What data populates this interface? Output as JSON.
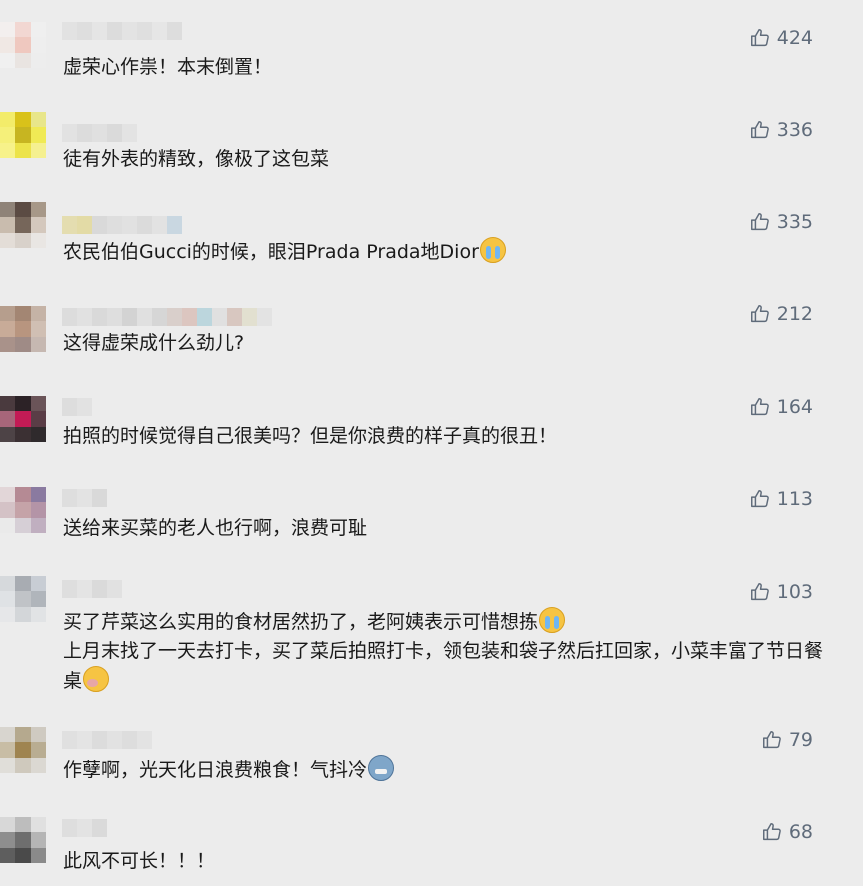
{
  "comments": [
    {
      "text": "虚荣心作祟！本末倒置！",
      "likes": "424"
    },
    {
      "text": "徒有外表的精致，像极了这包菜",
      "likes": "336"
    },
    {
      "text": "农民伯伯Gucci的时候，眼泪Prada Prada地Dior",
      "likes": "335"
    },
    {
      "text": "这得虚荣成什么劲儿?",
      "likes": "212"
    },
    {
      "text": "拍照的时候觉得自己很美吗？但是你浪费的样子真的很丑！",
      "likes": "164"
    },
    {
      "text": "送给来买菜的老人也行啊，浪费可耻",
      "likes": "113"
    },
    {
      "text": "买了芹菜这么实用的食材居然扔了，老阿姨表示可惜想拣",
      "text2": "上月末找了一天去打卡，买了菜后拍照打卡，领包装和袋子然后扛回家，小菜丰富了节日餐桌",
      "likes": "103"
    },
    {
      "text": "作孽啊，光天化日浪费粮食！气抖冷",
      "likes": "79"
    },
    {
      "text": "此风不可长！！！",
      "likes": "68"
    }
  ],
  "icons": {
    "like": "thumbs-up-icon",
    "emoji_cry": "crying-face-icon",
    "emoji_sick": "sick-face-icon",
    "emoji_cold": "cold-face-icon"
  },
  "colors": {
    "background": "#ececec",
    "like_text": "#5f6b7a"
  }
}
